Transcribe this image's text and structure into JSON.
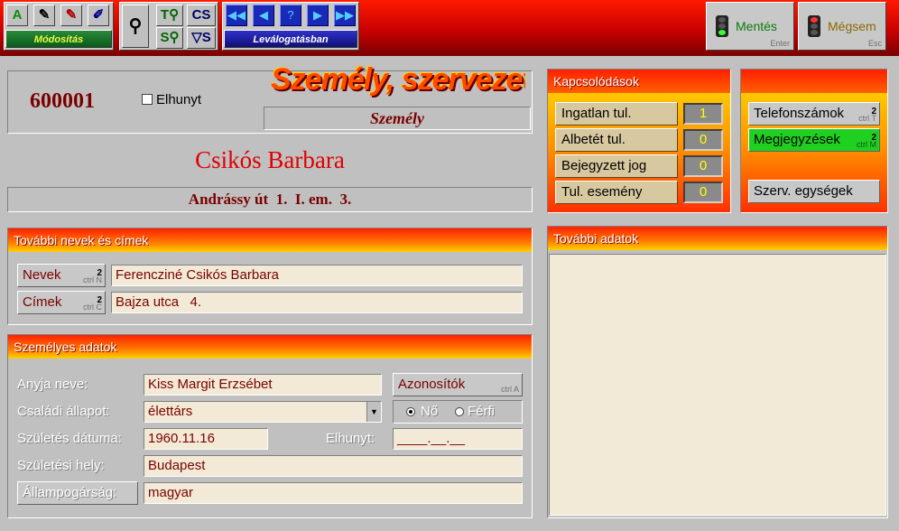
{
  "toolbar": {
    "edit_caption": "Módosítás",
    "filter_caption": "Leválogatásban",
    "edit_icons": [
      "add-icon",
      "edit-icon",
      "edit-all-icon",
      "erase-icon"
    ],
    "search_icons": [
      "search-icon",
      "text-search-icon",
      "group-search-icon",
      "s-search-icon",
      "filter-icon"
    ],
    "nav_icons": [
      "first-record-icon",
      "previous-record-icon",
      "help-icon",
      "next-record-icon",
      "last-record-icon"
    ],
    "nav_glyphs": [
      "◀◀",
      "◀",
      "?",
      "▶",
      "▶▶"
    ],
    "save": {
      "label": "Mentés",
      "hint": "Enter"
    },
    "cancel": {
      "label": "Mégsem",
      "hint": "Esc"
    }
  },
  "header": {
    "id": "600001",
    "deceased_label": "Elhunyt",
    "logo_text": "Személy, szervezet",
    "entity_type": "Személy"
  },
  "person": {
    "name": "Csikós Barbara",
    "address": "Andrássy út  1.  I. em.  3."
  },
  "names_section": {
    "title": "További nevek és címek",
    "rows": [
      {
        "button": "Nevek",
        "count": "2",
        "shortcut": "ctrl N",
        "value": "Ferencziné Csikós Barbara"
      },
      {
        "button": "Címek",
        "count": "2",
        "shortcut": "ctrl C",
        "value": "Bajza utca   4."
      }
    ]
  },
  "personal": {
    "title": "Személyes adatok",
    "mother_label": "Anyja neve:",
    "mother_value": "Kiss Margit Erzsébet",
    "ids_button": "Azonosítók",
    "ids_shortcut": "ctrl A",
    "marital_label": "Családi állapot:",
    "marital_value": "élettárs",
    "gender_female": "Nő",
    "gender_male": "Férfi",
    "birth_label": "Születés dátuma:",
    "birth_value": "1960.11.16",
    "died_label": "Elhunyt:",
    "died_value": "____.__.__",
    "birthplace_label": "Születési hely:",
    "birthplace_value": "Budapest",
    "citizenship_button": "Állampogárság:",
    "citizenship_value": "magyar"
  },
  "links": {
    "title": "Kapcsolódások",
    "items": [
      {
        "label": "Ingatlan tul.",
        "count": "1"
      },
      {
        "label": "Albetét tul.",
        "count": "0"
      },
      {
        "label": "Bejegyzett jog",
        "count": "0"
      },
      {
        "label": "Tul. esemény",
        "count": "0"
      }
    ]
  },
  "extra": {
    "phones_label": "Telefonszámok",
    "phones_count": "2",
    "phones_shortcut": "ctrl T",
    "notes_label": "Megjegyzések",
    "notes_count": "2",
    "notes_shortcut": "ctrl M",
    "units_label": "Szerv. egységek"
  },
  "more": {
    "title": "További adatok"
  }
}
